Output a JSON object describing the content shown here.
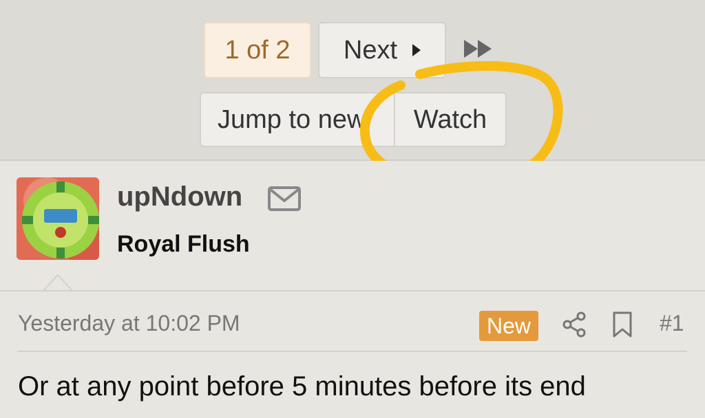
{
  "pagination": {
    "page_label": "1 of 2",
    "next_label": "Next",
    "last_icon": "double-chevron-right-icon"
  },
  "actions": {
    "jump_label": "Jump to new",
    "watch_label": "Watch"
  },
  "highlight": {
    "color": "#f7bd16"
  },
  "post": {
    "username": "upNdown",
    "user_title": "Royal Flush",
    "mail_icon": "envelope-icon",
    "date": "Yesterday at 10:02 PM",
    "badge": "New",
    "badge_color": "#e49a3c",
    "share_icon": "share-icon",
    "bookmark_icon": "bookmark-icon",
    "number": "#1",
    "message": "Or at any point before 5 minutes before its end"
  }
}
